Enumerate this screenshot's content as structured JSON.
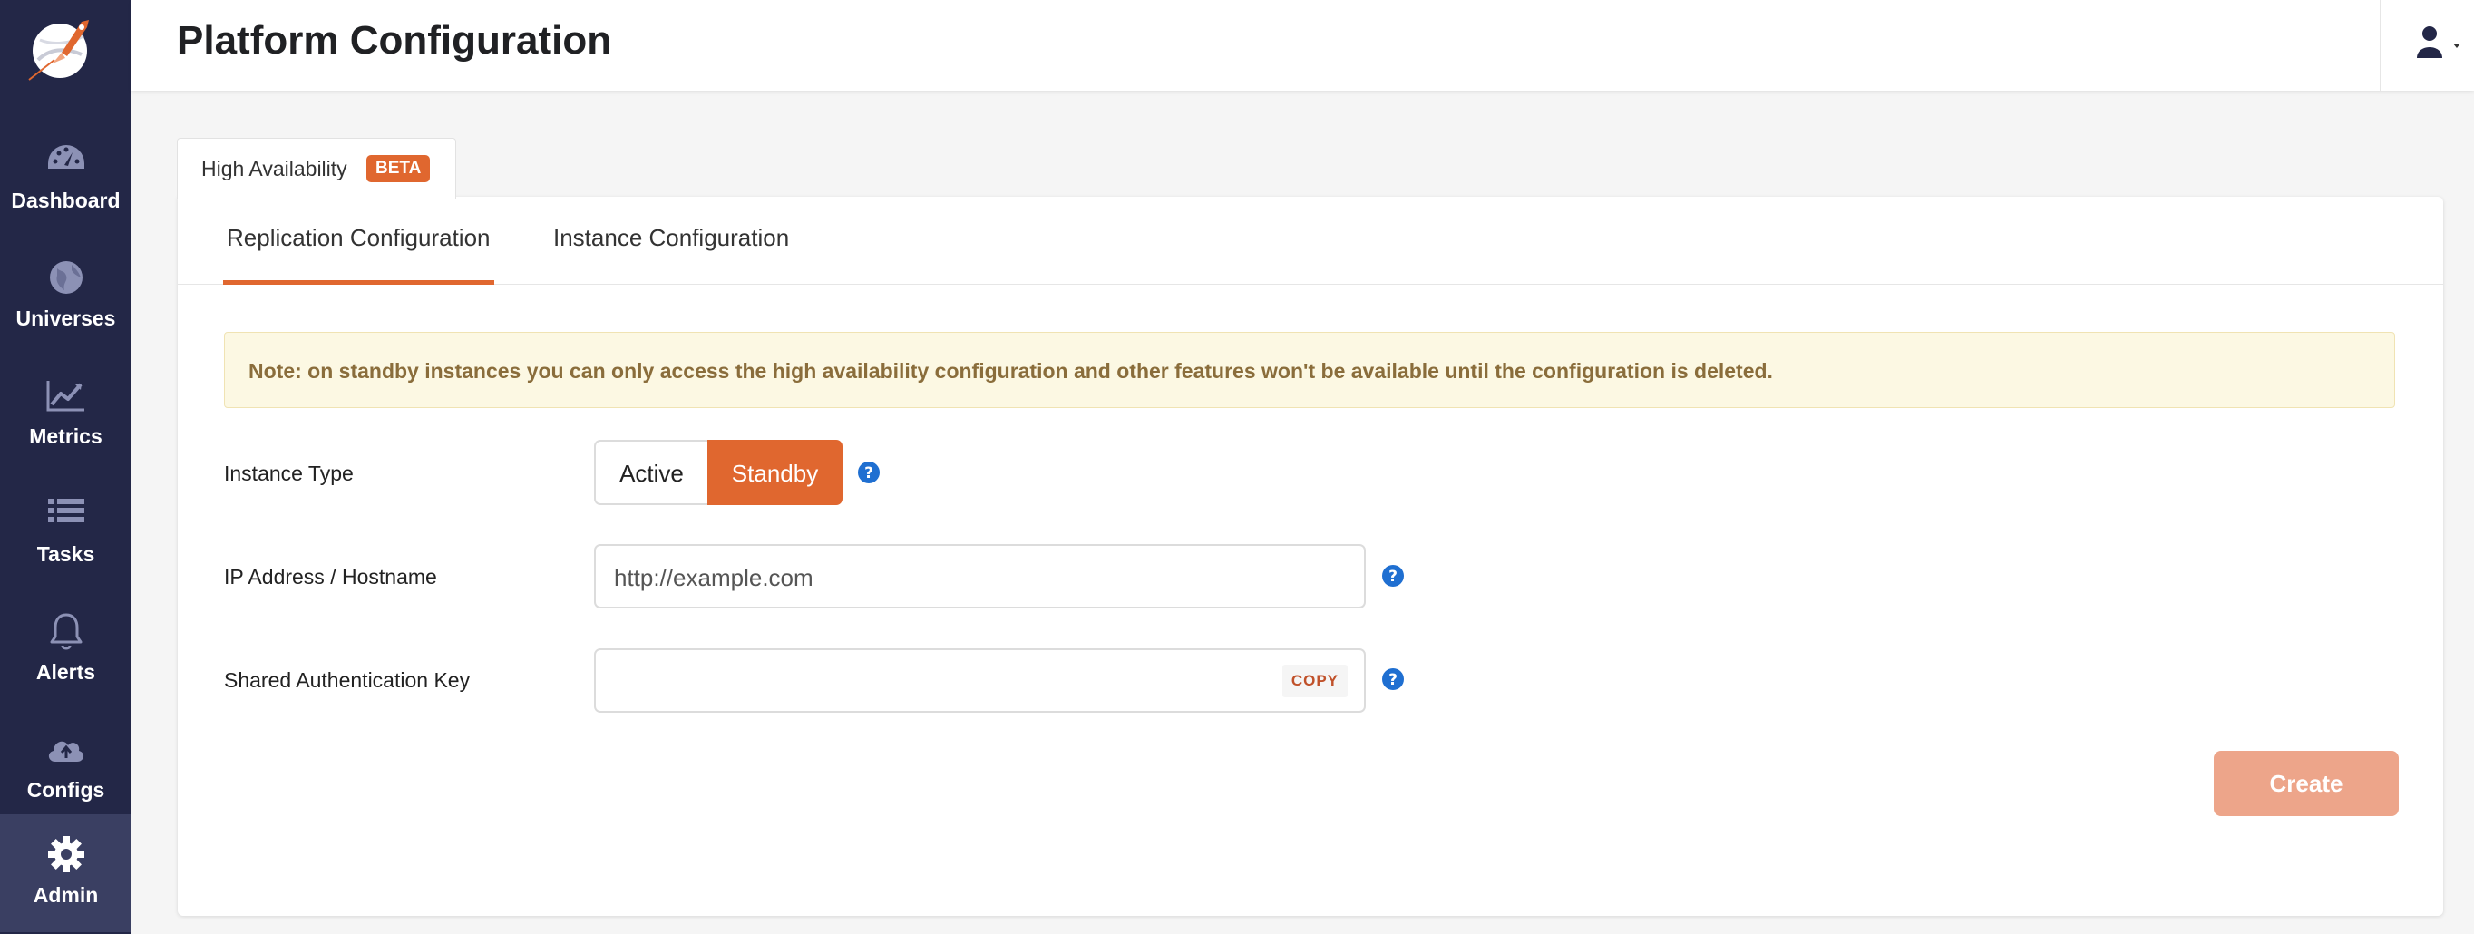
{
  "app": {
    "page_title": "Platform Configuration"
  },
  "sidebar": {
    "items": [
      {
        "label": "Dashboard",
        "icon": "gauge-icon"
      },
      {
        "label": "Universes",
        "icon": "globe-icon"
      },
      {
        "label": "Metrics",
        "icon": "line-chart-icon"
      },
      {
        "label": "Tasks",
        "icon": "list-icon"
      },
      {
        "label": "Alerts",
        "icon": "bell-icon"
      },
      {
        "label": "Configs",
        "icon": "cloud-upload-icon"
      },
      {
        "label": "Admin",
        "icon": "gear-icon",
        "active": true
      }
    ]
  },
  "outer_tab": {
    "label": "High Availability",
    "badge": "BETA"
  },
  "inner_tabs": [
    {
      "label": "Replication Configuration",
      "active": true
    },
    {
      "label": "Instance Configuration",
      "active": false
    }
  ],
  "note": {
    "text": "Note: on standby instances you can only access the high availability configuration and other features won't be available until the configuration is deleted."
  },
  "form": {
    "instance_type": {
      "label": "Instance Type",
      "options": [
        "Active",
        "Standby"
      ],
      "selected": "Standby"
    },
    "ip_address": {
      "label": "IP Address / Hostname",
      "value": "http://example.com"
    },
    "shared_key": {
      "label": "Shared Authentication Key",
      "value": "",
      "copy_label": "COPY"
    },
    "create_label": "Create"
  },
  "colors": {
    "sidebar_bg": "#232747",
    "accent": "#e0672f",
    "note_bg": "#fcf8e3",
    "note_text": "#8a6d3b",
    "help_icon": "#1f6fd1",
    "create_disabled": "#eda58a"
  }
}
